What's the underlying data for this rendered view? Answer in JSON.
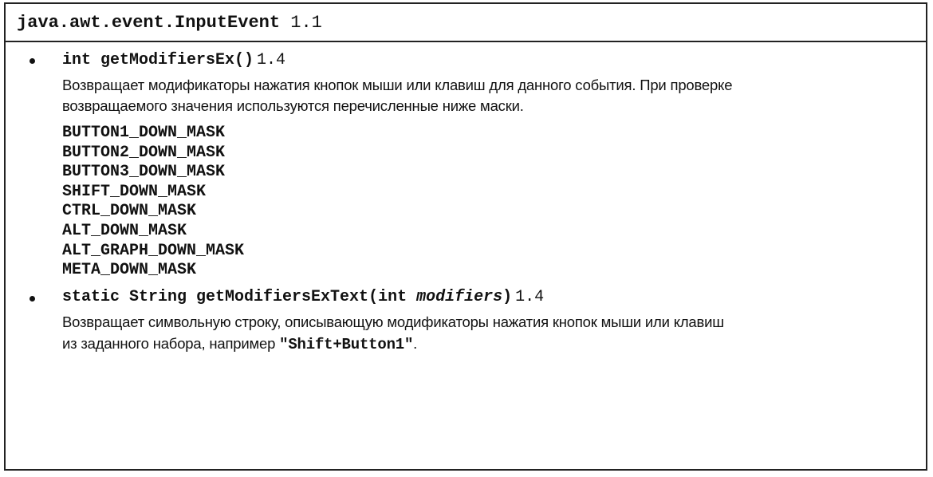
{
  "header": {
    "class_name": "java.awt.event.InputEvent",
    "version": "1.1"
  },
  "methods": [
    {
      "signature": "int getModifiersEx()",
      "version": "1.4",
      "description_lines": [
        "Возвращает модификаторы нажатия кнопок мыши или клавиш для данного события. При проверке",
        "возвращаемого значения используются перечисленные ниже маски."
      ],
      "masks": [
        "BUTTON1_DOWN_MASK",
        "BUTTON2_DOWN_MASK",
        "BUTTON3_DOWN_MASK",
        "SHIFT_DOWN_MASK",
        "CTRL_DOWN_MASK",
        "ALT_DOWN_MASK",
        "ALT_GRAPH_DOWN_MASK",
        "META_DOWN_MASK"
      ]
    },
    {
      "signature_prefix": "static String getModifiersExText(int ",
      "signature_param": "modifiers",
      "signature_suffix": ")",
      "version": "1.4",
      "description_lines": [
        "Возвращает символьную строку, описывающую модификаторы нажатия кнопок мыши или клавиш",
        "из заданного набора, например "
      ],
      "example": "\"Shift+Button1\"",
      "example_end": "."
    }
  ]
}
